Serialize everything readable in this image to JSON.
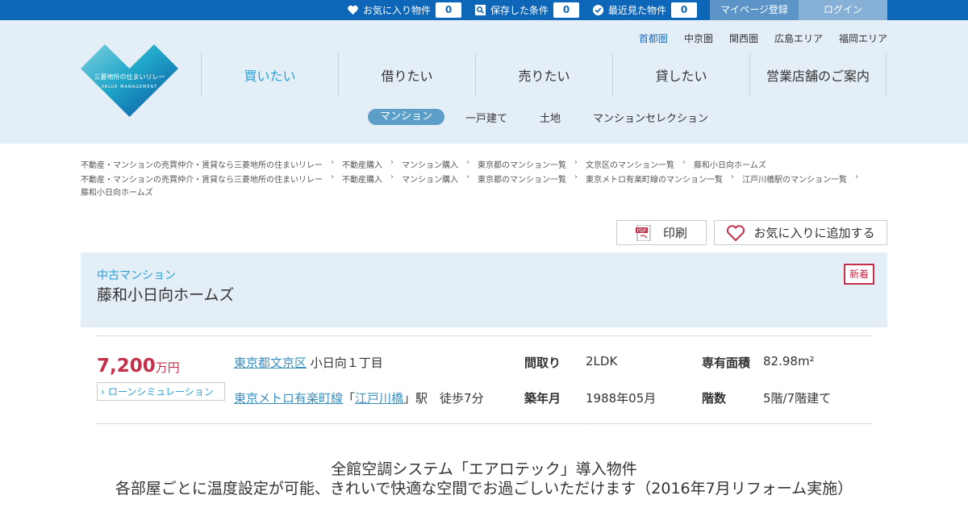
{
  "topbar": {
    "favorites_label": "お気に入り物件",
    "favorites_count": "0",
    "saved_label": "保存した条件",
    "saved_count": "0",
    "recent_label": "最近見た物件",
    "recent_count": "0",
    "mypage_label": "マイページ登録",
    "login_label": "ログイン"
  },
  "logo": {
    "text": "三菱地所の住まいリレー",
    "sub": "VALUE MANAGEMENT",
    "colors": [
      "#0b4fa0",
      "#1fa6c8",
      "#7fd0e0"
    ]
  },
  "areas": [
    "首都圏",
    "中京圏",
    "関西圏",
    "広島エリア",
    "福岡エリア"
  ],
  "main_nav": [
    "買いたい",
    "借りたい",
    "売りたい",
    "貸したい",
    "営業店舗のご案内"
  ],
  "sub_nav": [
    "マンション",
    "一戸建て",
    "土地",
    "マンションセレクション"
  ],
  "breadcrumb1": [
    "不動産・マンションの売買仲介・賃貸なら三菱地所の住まいリレー",
    "不動産購入",
    "マンション購入",
    "東京都のマンション一覧",
    "文京区のマンション一覧",
    "藤和小日向ホームズ"
  ],
  "breadcrumb2": [
    "不動産・マンションの売買仲介・賃貸なら三菱地所の住まいリレー",
    "不動産購入",
    "マンション購入",
    "東京都のマンション一覧",
    "東京メトロ有楽町線のマンション一覧",
    "江戸川橋駅のマンション一覧"
  ],
  "breadcrumb3": "藤和小日向ホームズ",
  "actions": {
    "print_label": "印刷",
    "favorite_label": "お気に入りに追加する"
  },
  "property": {
    "type": "中古マンション",
    "name": "藤和小日向ホームズ",
    "badge": "新着",
    "price": "7,200",
    "price_unit": "万円",
    "loan_label": "ローンシミュレーション",
    "address_link": "東京都文京区",
    "address_rest": "小日向１丁目",
    "line_link": "東京メトロ有楽町線",
    "station_open": "「",
    "station_link": "江戸川橋",
    "station_close": "」駅　徒歩7分",
    "layout_label": "間取り",
    "layout_value": "2LDK",
    "area_label": "専有面積",
    "area_value": "82.98m²",
    "built_label": "築年月",
    "built_value": "1988年05月",
    "floor_label": "階数",
    "floor_value": "5階/7階建て"
  },
  "catch": {
    "line1": "全館空調システム「エアロテック」導入物件",
    "line2": "各部屋ごとに温度設定が可能、きれいで快適な空間でお過ごしいただけます（2016年7月リフォーム実施）"
  },
  "colors": {
    "topbar": "#0e66b8",
    "header_bg": "#e4eef6",
    "accent": "#2a9fd6",
    "price": "#c2304a"
  }
}
